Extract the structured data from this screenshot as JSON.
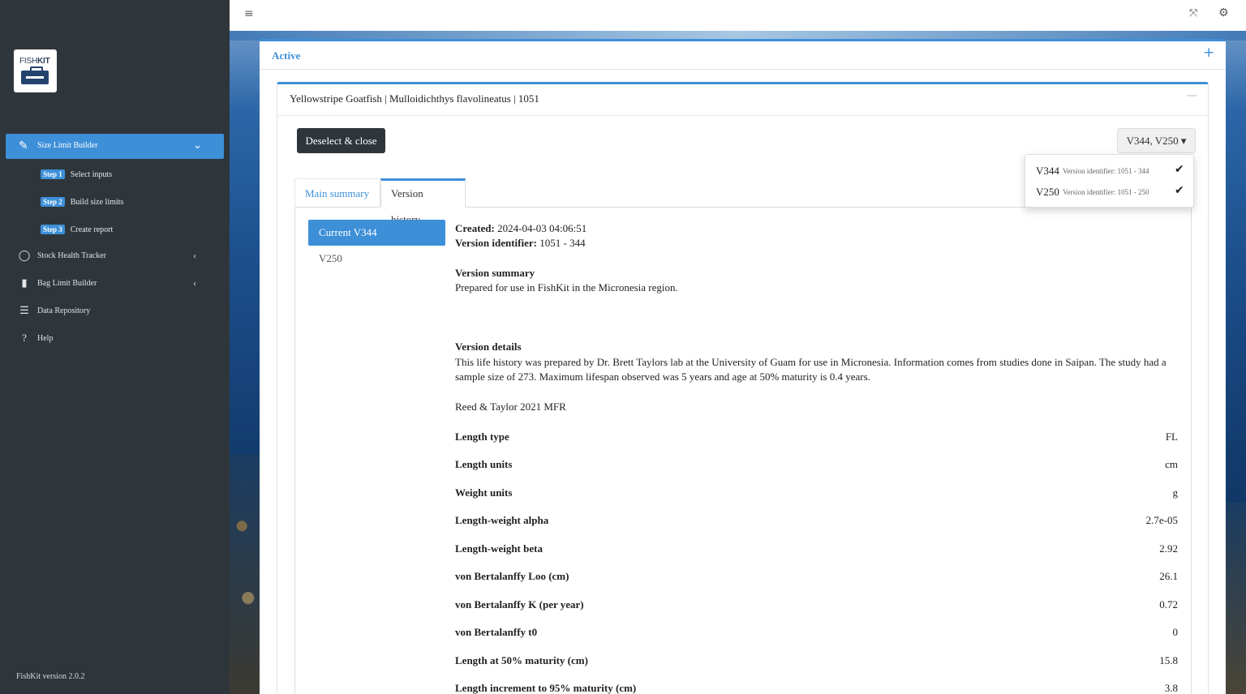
{
  "sidebar": {
    "logo": {
      "text_light": "FISH",
      "text_bold": "KIT"
    },
    "active_item": {
      "label": "Size Limit Builder",
      "icon": "ruler-icon"
    },
    "steps": [
      {
        "badge": "Step 1",
        "label": "Select inputs"
      },
      {
        "badge": "Step 2",
        "label": "Build size limits"
      },
      {
        "badge": "Step 3",
        "label": "Create report"
      }
    ],
    "items": [
      {
        "label": "Stock Health Tracker",
        "icon": "circle-icon",
        "glyph": "◯"
      },
      {
        "label": "Bag Limit Builder",
        "icon": "bar-chart-icon",
        "glyph": "▮"
      },
      {
        "label": "Data Repository",
        "icon": "database-icon",
        "glyph": "☰"
      },
      {
        "label": "Help",
        "icon": "question-icon",
        "glyph": "?"
      }
    ],
    "version": "FishKit version 2.0.2"
  },
  "topbar": {
    "menu_glyph": "≡",
    "expand_glyph": "⤧",
    "settings_glyph": "⚙"
  },
  "card": {
    "title": "Active",
    "add_glyph": "+"
  },
  "species": {
    "title": "Yellowstripe Goatfish | Mulloidichthys flavolineatus | 1051",
    "minimize_glyph": "—",
    "deselect_label": "Deselect & close",
    "version_select_label": "V344, V250 ▾"
  },
  "dropdown": {
    "options": [
      {
        "name": "V344",
        "identifier": "Version identifier: 1051 - 344",
        "checked": "✔"
      },
      {
        "name": "V250",
        "identifier": "Version identifier: 1051 - 250",
        "checked": "✔"
      }
    ]
  },
  "tabs": [
    {
      "label": "Main summary"
    },
    {
      "label": "Version history"
    }
  ],
  "version_list": {
    "current": "Current V344",
    "other": "V250"
  },
  "details": {
    "created_label": "Created:",
    "created_value": "2024-04-03 04:06:51",
    "identifier_label": "Version identifier:",
    "identifier_value": "1051 - 344",
    "summary_heading": "Version summary",
    "summary_text": "Prepared for use in FishKit in the Micronesia region.",
    "details_heading": "Version details",
    "details_text": "This life history was prepared by Dr. Brett Taylors lab at the University of Guam for use in Micronesia. Information comes from studies done in Saipan. The study had a sample size of 273. Maximum lifespan observed was 5 years and age at 50% maturity is 0.4 years.",
    "reference": "Reed & Taylor 2021 MFR",
    "rows": [
      {
        "label": "Length type",
        "value": "FL"
      },
      {
        "label": "Length units",
        "value": "cm"
      },
      {
        "label": "Weight units",
        "value": "g"
      },
      {
        "label": "Length-weight alpha",
        "value": "2.7e-05"
      },
      {
        "label": "Length-weight beta",
        "value": "2.92"
      },
      {
        "label": "von Bertalanffy Loo (cm)",
        "value": "26.1"
      },
      {
        "label": "von Bertalanffy K (per year)",
        "value": "0.72"
      },
      {
        "label": "von Bertalanffy t0",
        "value": "0"
      },
      {
        "label": "Length at 50% maturity (cm)",
        "value": "15.8"
      },
      {
        "label": "Length increment to 95% maturity (cm)",
        "value": "3.8"
      }
    ]
  }
}
